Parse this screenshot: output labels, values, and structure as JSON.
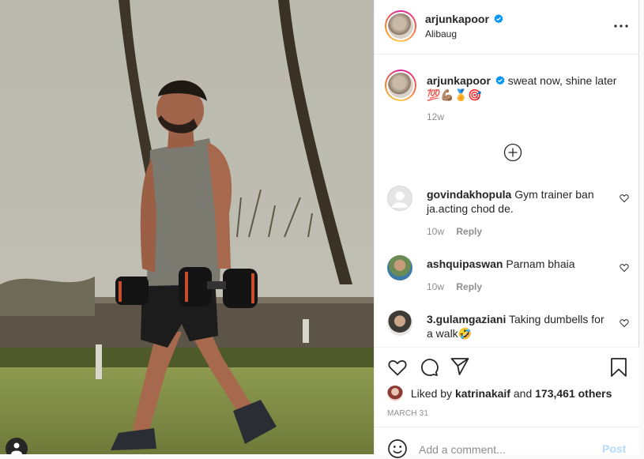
{
  "post": {
    "author": "arjunkapoor",
    "location": "Alibaug",
    "caption_text": "sweat now, shine later",
    "caption_emojis": "💯💪🏽🏅🎯",
    "caption_time": "12w",
    "verified_icon": "verified-badge-icon",
    "accent_color": "#0095f6"
  },
  "comments": [
    {
      "user": "govindakhopula",
      "text": "Gym trainer ban ja.acting chod de.",
      "time": "10w",
      "reply": "Reply"
    },
    {
      "user": "ashquipaswan",
      "text": "Parnam bhaia",
      "time": "10w",
      "reply": "Reply"
    },
    {
      "user": "3.gulamgaziani",
      "text": "Taking dumbells for a walk🤣",
      "time": "",
      "reply": ""
    }
  ],
  "likes": {
    "prefix": "Liked by",
    "user": "katrinakaif",
    "joiner": "and",
    "count": "173,461 others"
  },
  "date": "MARCH 31",
  "add_comment": {
    "placeholder": "Add a comment...",
    "post_label": "Post"
  }
}
